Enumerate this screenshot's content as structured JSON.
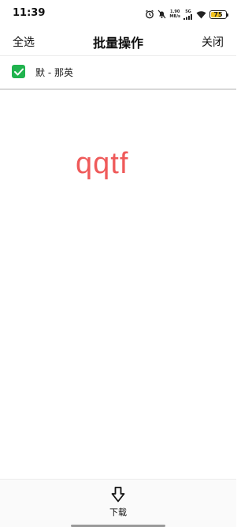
{
  "status_bar": {
    "time": "11:39",
    "speed_value": "1.90",
    "speed_unit": "MB/s",
    "network_label": "5G",
    "battery_level": "75",
    "battery_fill_percent": 75,
    "icons": [
      "alarm-icon",
      "mute-bell-icon",
      "network-speed-icon",
      "signal-icon",
      "wifi-icon",
      "battery-icon"
    ]
  },
  "header": {
    "select_all_label": "全选",
    "title": "批量操作",
    "close_label": "关闭"
  },
  "list": {
    "items": [
      {
        "label": "默 - 那英",
        "checked": true
      }
    ]
  },
  "watermark": {
    "text": "qqtf",
    "color": "#ef5a5a"
  },
  "bottom_bar": {
    "download_label": "下载"
  },
  "colors": {
    "accent_green": "#20b34e",
    "battery_yellow": "#f2c31f"
  }
}
